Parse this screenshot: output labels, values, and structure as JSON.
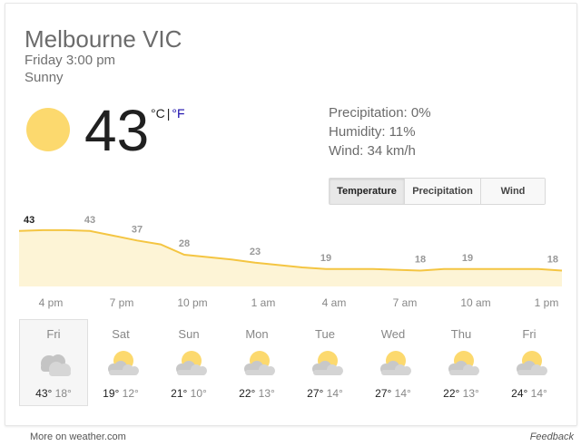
{
  "header": {
    "location": "Melbourne VIC",
    "datetime": "Friday 3:00 pm",
    "condition": "Sunny"
  },
  "current": {
    "temperature": "43",
    "unit_c": "°C",
    "unit_sep": "|",
    "unit_f": "°F",
    "icon": "sun-icon"
  },
  "details": {
    "precipitation": "Precipitation: 0%",
    "humidity": "Humidity: 11%",
    "wind": "Wind: 34 km/h"
  },
  "tabs": [
    {
      "label": "Temperature",
      "active": true
    },
    {
      "label": "Precipitation",
      "active": false
    },
    {
      "label": "Wind",
      "active": false
    }
  ],
  "chart_data": {
    "type": "area",
    "x": [
      "4 pm",
      "5 pm",
      "6 pm",
      "7 pm",
      "8 pm",
      "9 pm",
      "10 pm",
      "11 pm",
      "12 am",
      "1 am",
      "2 am",
      "3 am",
      "4 am",
      "5 am",
      "6 am",
      "7 am",
      "8 am",
      "9 am",
      "10 am",
      "11 am",
      "12 pm",
      "1 pm",
      "2 pm",
      "3 pm"
    ],
    "values": [
      43,
      43.5,
      43.5,
      43,
      40,
      37,
      34.5,
      28,
      26.5,
      25,
      23,
      21.5,
      20,
      19,
      19,
      19,
      18.5,
      18,
      19,
      19,
      19,
      19,
      19,
      18
    ],
    "point_labels": [
      "43",
      "43",
      "37",
      "28",
      "23",
      "19",
      "18",
      "19",
      "18"
    ],
    "point_label_index": [
      0,
      3,
      5,
      7,
      10,
      13,
      17,
      19,
      23
    ],
    "tick_labels": [
      "4 pm",
      "7 pm",
      "10 pm",
      "1 am",
      "4 am",
      "7 am",
      "10 am",
      "1 pm"
    ],
    "tick_label_index": [
      0,
      3,
      6,
      9,
      12,
      15,
      18,
      21
    ],
    "ylim": [
      0,
      48
    ],
    "line_color": "#f4c542",
    "fill_color": "#fdf4d6",
    "label_color": "#999999",
    "highlight_label_color": "#212121"
  },
  "forecast": [
    {
      "day": "Fri",
      "hi": "43°",
      "lo": "18°",
      "icon": "cloudy-icon",
      "selected": true
    },
    {
      "day": "Sat",
      "hi": "19°",
      "lo": "12°",
      "icon": "partly-cloudy-icon",
      "selected": false
    },
    {
      "day": "Sun",
      "hi": "21°",
      "lo": "10°",
      "icon": "partly-cloudy-icon",
      "selected": false
    },
    {
      "day": "Mon",
      "hi": "22°",
      "lo": "13°",
      "icon": "partly-cloudy-icon",
      "selected": false
    },
    {
      "day": "Tue",
      "hi": "27°",
      "lo": "14°",
      "icon": "partly-cloudy-icon",
      "selected": false
    },
    {
      "day": "Wed",
      "hi": "27°",
      "lo": "14°",
      "icon": "partly-cloudy-icon",
      "selected": false
    },
    {
      "day": "Thu",
      "hi": "22°",
      "lo": "13°",
      "icon": "partly-cloudy-icon",
      "selected": false
    },
    {
      "day": "Fri",
      "hi": "24°",
      "lo": "14°",
      "icon": "partly-cloudy-icon",
      "selected": false
    }
  ],
  "footer": {
    "source_link": "More on weather.com",
    "feedback": "Feedback"
  },
  "colors": {
    "sun": "#fcd96e",
    "cloud": "#d6d6d6",
    "cloud_grey": "#c4c4c4",
    "link_blue": "#1a0dab"
  }
}
